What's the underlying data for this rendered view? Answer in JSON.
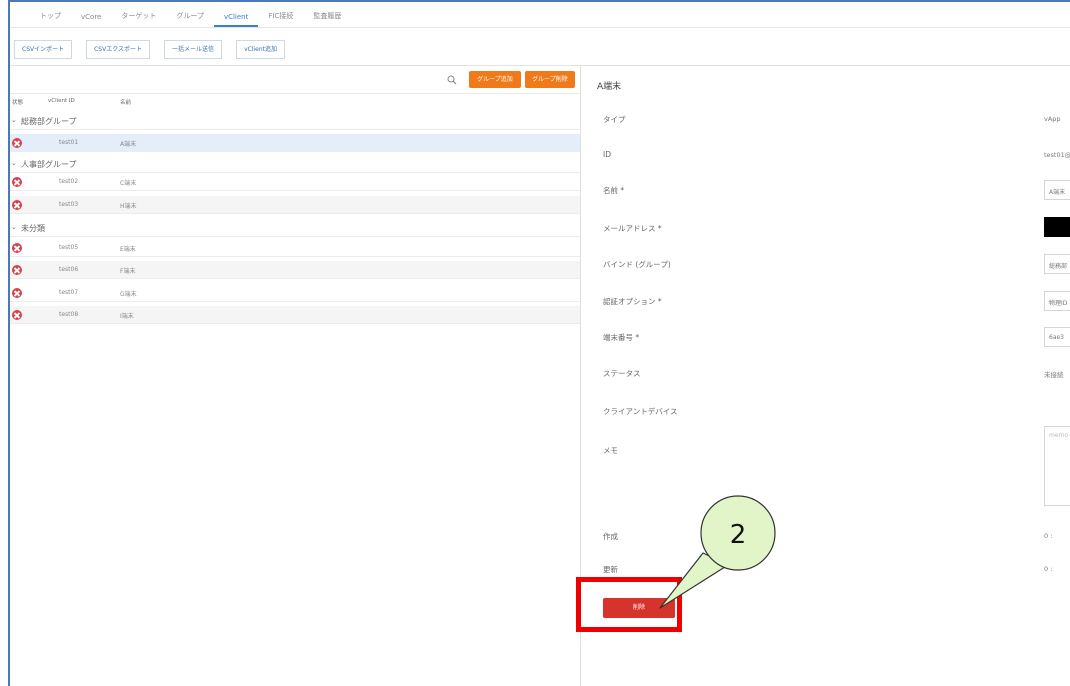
{
  "nav": {
    "tabs": [
      {
        "label": "トップ"
      },
      {
        "label": "vCore"
      },
      {
        "label": "ターゲット"
      },
      {
        "label": "グループ"
      },
      {
        "label": "vClient"
      },
      {
        "label": "FIC接続"
      },
      {
        "label": "監査履歴"
      }
    ],
    "active_tab": "vClient"
  },
  "toolbar": {
    "csv_import": "CSVインポート",
    "csv_export": "CSVエクスポート",
    "bulk_mail": "一括メール送信",
    "add_vclient": "vClient追加"
  },
  "list": {
    "search_placeholder": "",
    "group_add_label": "グループ追加",
    "group_delete_label": "グループ削除",
    "columns": {
      "status": "状態",
      "id": "vClient ID",
      "name": "名前"
    },
    "groups": [
      {
        "name": "総務部グループ",
        "items": [
          {
            "id": "test01",
            "name": "A端末"
          }
        ]
      },
      {
        "name": "人事部グループ",
        "items": [
          {
            "id": "test02",
            "name": "C端末"
          },
          {
            "id": "test03",
            "name": "H端末"
          }
        ]
      },
      {
        "name": "未分類",
        "items": [
          {
            "id": "test05",
            "name": "E端末"
          },
          {
            "id": "test06",
            "name": "F端末"
          },
          {
            "id": "test07",
            "name": "G端末"
          },
          {
            "id": "test08",
            "name": "I端末"
          }
        ]
      }
    ]
  },
  "detail": {
    "title": "A端末",
    "labels": {
      "type": "タイプ",
      "id": "ID",
      "name": "名前 *",
      "email": "メールアドレス *",
      "bind": "バインド (グループ)",
      "auth": "認証オプション *",
      "serial": "端末番号 *",
      "status": "ステータス",
      "client_device": "クライアントデバイス",
      "memo": "メモ",
      "created": "作成",
      "updated": "更新"
    },
    "values": {
      "type": "vApp",
      "id": "test01@",
      "name": "A端末",
      "bind": "総務部",
      "auth": "物理ID",
      "serial": "6ae3",
      "status": "未接続",
      "memo_placeholder": "memo",
      "created": "0 :",
      "updated": "0 :"
    },
    "delete_button": "削除"
  },
  "annotation": {
    "step_number": "2"
  },
  "colors": {
    "accent": "#3b7fd4",
    "orange": "#f07a1a",
    "danger": "#d5332b",
    "highlight": "#f00000",
    "callout_fill": "#e2f5c8"
  }
}
